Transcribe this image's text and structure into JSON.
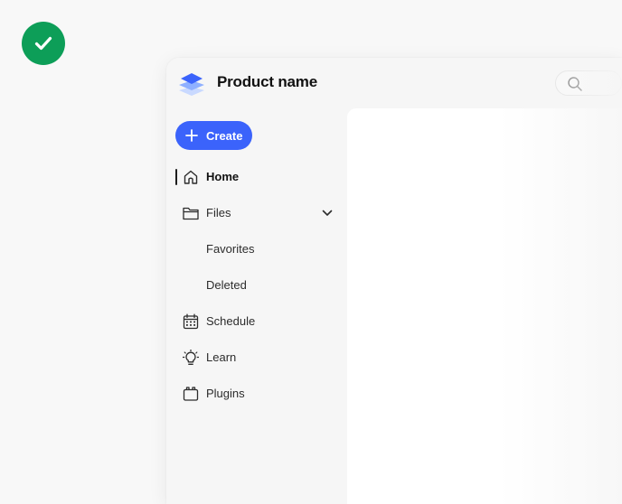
{
  "badge": {
    "icon": "checkmark-icon",
    "color": "#0d9e58"
  },
  "app": {
    "product_name": "Product name",
    "logo_icon": "stacked-layers-logo-icon",
    "search": {
      "icon": "search-icon",
      "placeholder": ""
    }
  },
  "create": {
    "label": "Create",
    "icon": "plus-icon",
    "color": "#3b63fb"
  },
  "nav": {
    "items": [
      {
        "label": "Home",
        "icon": "home-icon",
        "active": true
      },
      {
        "label": "Files",
        "icon": "folder-icon",
        "expandable": true,
        "expanded": true
      },
      {
        "label": "Favorites",
        "icon": "",
        "child": true
      },
      {
        "label": "Deleted",
        "icon": "",
        "child": true
      },
      {
        "label": "Schedule",
        "icon": "calendar-icon"
      },
      {
        "label": "Learn",
        "icon": "lightbulb-icon"
      },
      {
        "label": "Plugins",
        "icon": "plugin-icon"
      }
    ]
  }
}
